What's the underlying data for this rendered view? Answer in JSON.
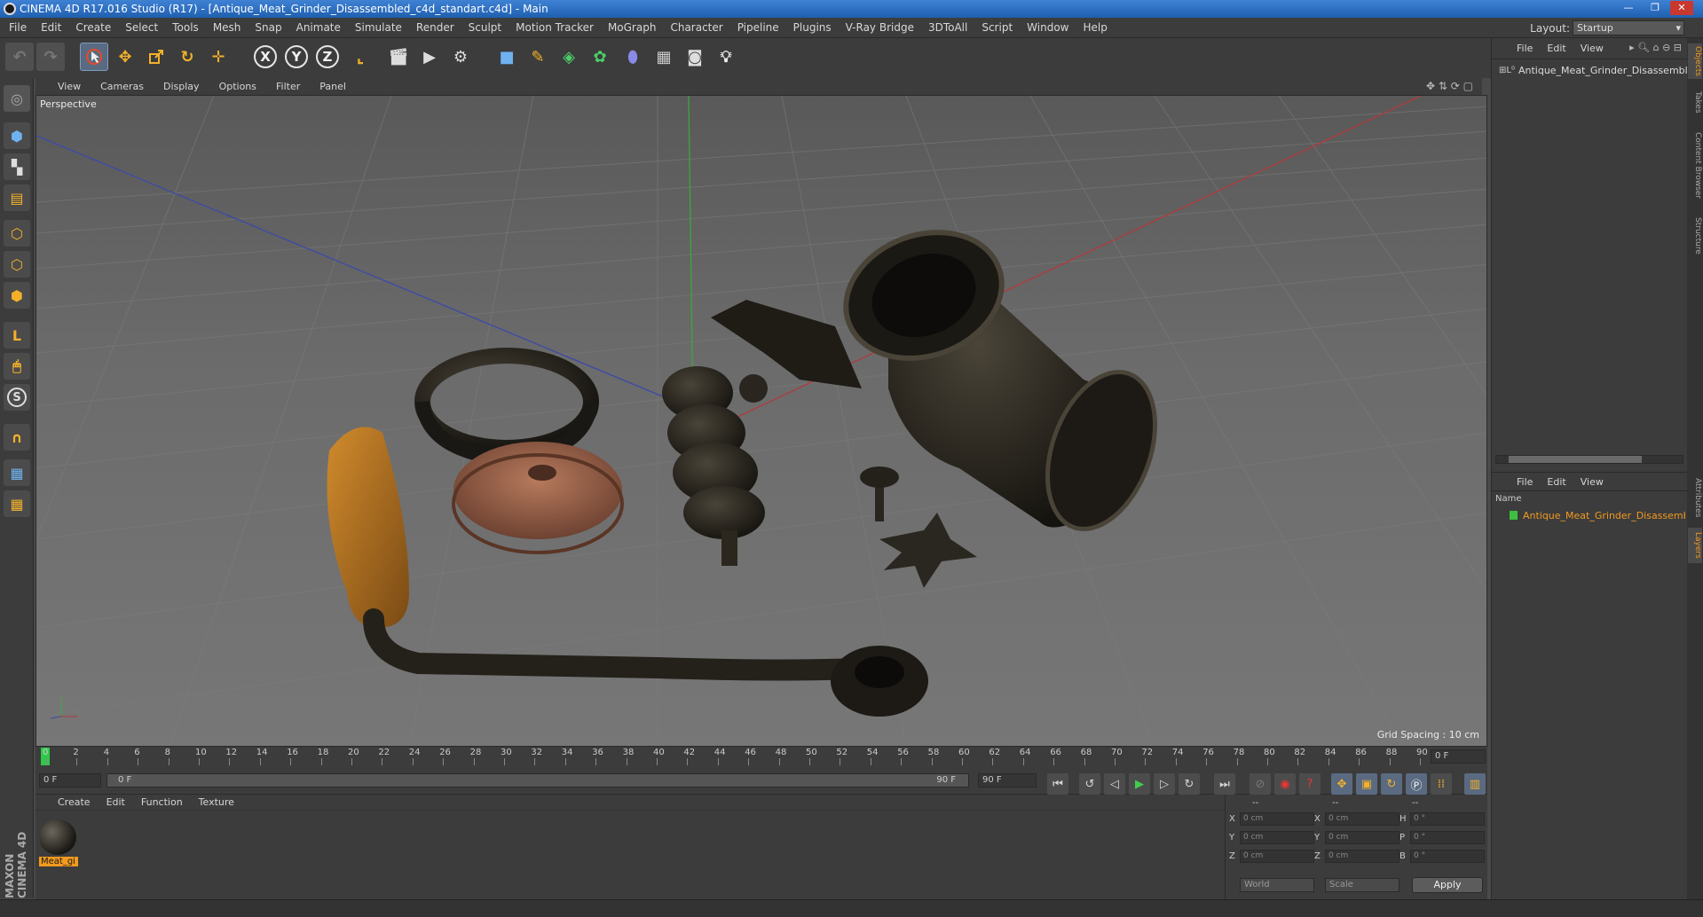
{
  "window": {
    "title": "CINEMA 4D R17.016 Studio (R17) - [Antique_Meat_Grinder_Disassembled_c4d_standart.c4d] - Main",
    "minimize": "—",
    "restore": "❐",
    "close": "✕"
  },
  "menu": [
    "File",
    "Edit",
    "Create",
    "Select",
    "Tools",
    "Mesh",
    "Snap",
    "Animate",
    "Simulate",
    "Render",
    "Sculpt",
    "Motion Tracker",
    "MoGraph",
    "Character",
    "Pipeline",
    "Plugins",
    "V-Ray Bridge",
    "3DToAll",
    "Script",
    "Window",
    "Help"
  ],
  "layout": {
    "label": "Layout:",
    "value": "Startup"
  },
  "toolbar": {
    "x": "X",
    "y": "Y",
    "z": "Z"
  },
  "viewport": {
    "menu": [
      "View",
      "Cameras",
      "Display",
      "Options",
      "Filter",
      "Panel"
    ],
    "camera_label": "Perspective",
    "grid_spacing": "Grid Spacing : 10 cm"
  },
  "timeline": {
    "ticks": [
      "0",
      "2",
      "4",
      "6",
      "8",
      "10",
      "12",
      "14",
      "16",
      "18",
      "20",
      "22",
      "24",
      "26",
      "28",
      "30",
      "32",
      "34",
      "36",
      "38",
      "40",
      "42",
      "44",
      "46",
      "48",
      "50",
      "52",
      "54",
      "56",
      "58",
      "60",
      "62",
      "64",
      "66",
      "68",
      "70",
      "72",
      "74",
      "76",
      "78",
      "80",
      "82",
      "84",
      "86",
      "88",
      "90"
    ],
    "current_frame": "0 F",
    "start_field": "0 F",
    "range_start": "0 F",
    "range_end": "90 F",
    "end_field": "90 F"
  },
  "materials": {
    "menu": [
      "Create",
      "Edit",
      "Function",
      "Texture"
    ],
    "items": [
      {
        "name": "Meat_gi"
      }
    ]
  },
  "coords": {
    "headers": [
      "--",
      "--",
      "--"
    ],
    "rows": [
      {
        "a": "X",
        "av": "0 cm",
        "b": "X",
        "bv": "0 cm",
        "c": "H",
        "cv": "0 °"
      },
      {
        "a": "Y",
        "av": "0 cm",
        "b": "Y",
        "bv": "0 cm",
        "c": "P",
        "cv": "0 °"
      },
      {
        "a": "Z",
        "av": "0 cm",
        "b": "Z",
        "bv": "0 cm",
        "c": "B",
        "cv": "0 °"
      }
    ],
    "world": "World",
    "scale": "Scale",
    "apply": "Apply"
  },
  "objects_panel": {
    "menu": [
      "File",
      "Edit",
      "View"
    ],
    "tree": [
      {
        "name": "Antique_Meat_Grinder_Disassembled"
      }
    ]
  },
  "layers_panel": {
    "menu": [
      "File",
      "Edit",
      "View"
    ],
    "header": "Name",
    "items": [
      {
        "name": "Antique_Meat_Grinder_Disassembled",
        "color": "#3fbf3f"
      }
    ]
  },
  "side_tabs": [
    "Objects",
    "Takes",
    "Content Browser",
    "Structure",
    "Attributes",
    "Layers"
  ],
  "brand": "MAXON CINEMA 4D",
  "accent": "#f29a1e"
}
